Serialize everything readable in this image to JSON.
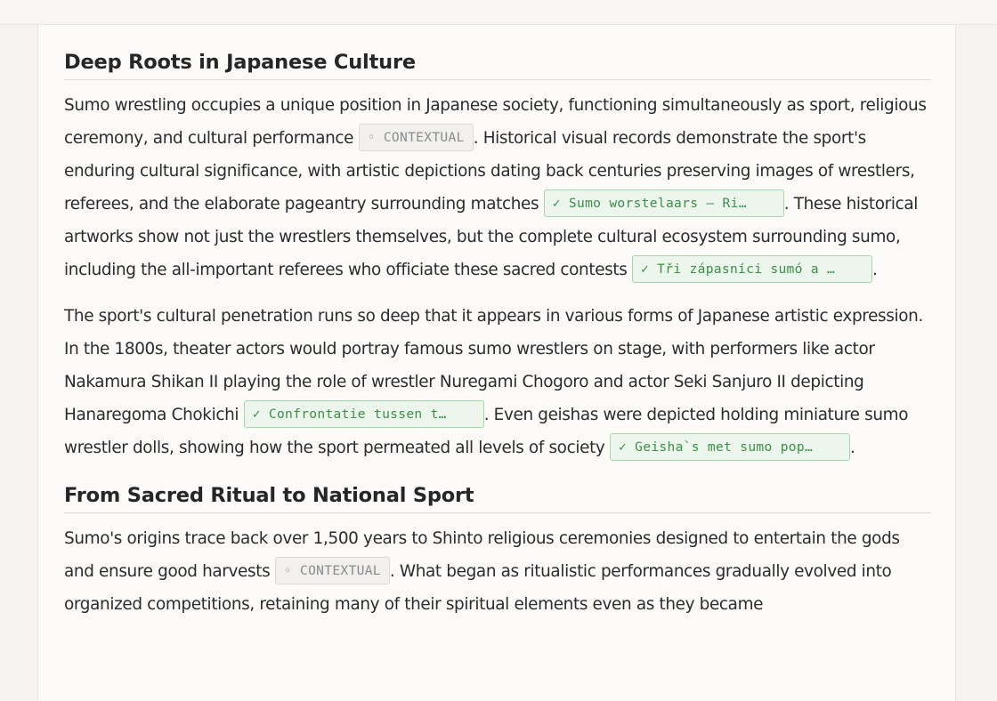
{
  "sections": [
    {
      "heading": "Deep Roots in Japanese Culture",
      "paragraphs": [
        {
          "parts": [
            "Sumo wrestling occupies a unique position in Japanese society, functioning simultaneously as sport, religious ceremony, and cultural performance ",
            ". Historical visual records demonstrate the sport's enduring cultural significance, with artistic depictions dating back centuries preserving images of wrestlers, referees, and the elaborate pageantry surrounding matches ",
            ". These historical artworks show not just the wrestlers themselves, but the complete cultural ecosystem surrounding sumo, including the all-important referees who officiate these sacred contests ",
            "."
          ],
          "citations": [
            {
              "type": "contextual",
              "label": "◦ CONTEXTUAL"
            },
            {
              "type": "verified",
              "label": "✓ Sumo worstelaars — Ri…"
            },
            {
              "type": "verified",
              "label": "✓ Tři zápasníci sumó a …"
            }
          ]
        },
        {
          "parts": [
            "The sport's cultural penetration runs so deep that it appears in various forms of Japanese artistic expression. In the 1800s, theater actors would portray famous sumo wrestlers on stage, with performers like actor Nakamura Shikan II playing the role of wrestler Nuregami Chogoro and actor Seki Sanjuro II depicting Hanaregoma Chokichi ",
            ". Even geishas were depicted holding miniature sumo wrestler dolls, showing how the sport permeated all levels of society ",
            "."
          ],
          "citations": [
            {
              "type": "verified",
              "label": "✓ Confrontatie tussen t…"
            },
            {
              "type": "verified",
              "label": "✓ Geisha`s met sumo pop…"
            }
          ]
        }
      ]
    },
    {
      "heading": "From Sacred Ritual to National Sport",
      "paragraphs": [
        {
          "parts": [
            "Sumo's origins trace back over 1,500 years to Shinto religious ceremonies designed to entertain the gods and ensure good harvests ",
            ". What began as ritualistic performances gradually evolved into organized competitions, retaining many of their spiritual elements even as they became"
          ],
          "citations": [
            {
              "type": "contextual",
              "label": "◦ CONTEXTUAL"
            }
          ]
        }
      ]
    }
  ],
  "colors": {
    "verified_bg": "#ecf6ec",
    "verified_text": "#3b8f46",
    "contextual_bg": "#f1f0ee",
    "contextual_text": "#8b8b8b"
  }
}
